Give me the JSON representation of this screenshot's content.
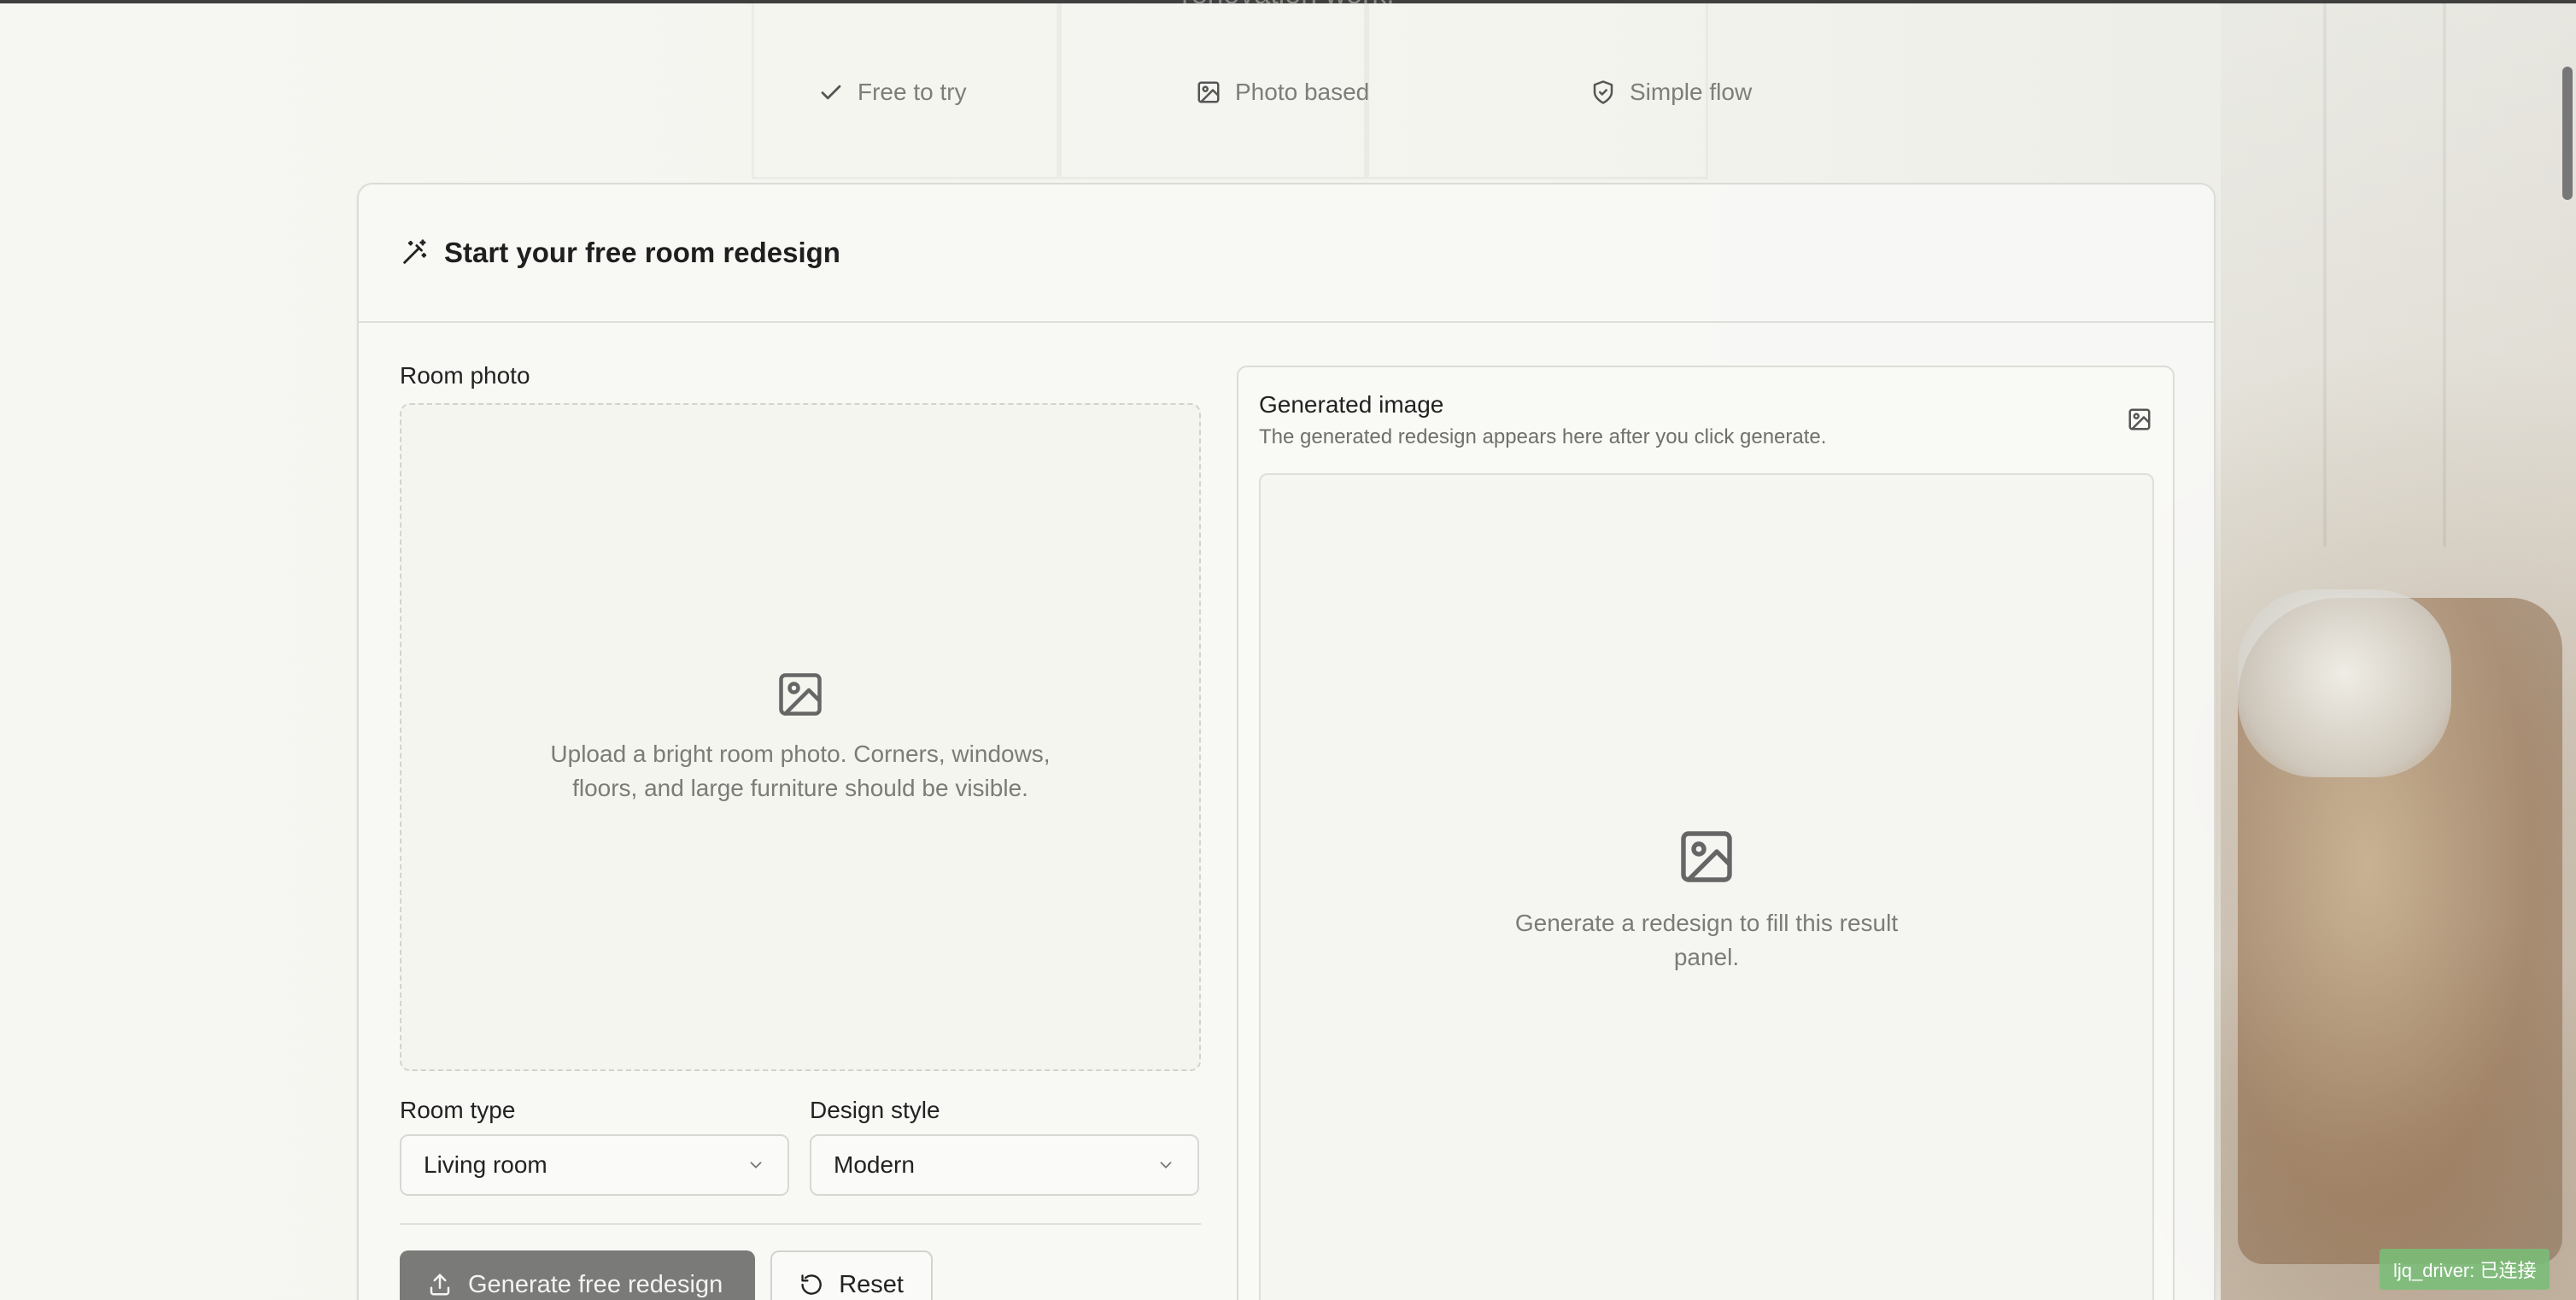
{
  "hero": {
    "subtitle": "renovation work."
  },
  "features": [
    {
      "label": "Free to try",
      "icon": "check-icon"
    },
    {
      "label": "Photo based",
      "icon": "image-icon"
    },
    {
      "label": "Simple flow",
      "icon": "shield-check-icon"
    }
  ],
  "card": {
    "title": "Start your free room redesign",
    "title_icon": "magic-wand-icon"
  },
  "upload": {
    "label": "Room photo",
    "hint": "Upload a bright room photo. Corners, windows, floors, and large furniture should be visible."
  },
  "room_type": {
    "label": "Room type",
    "value": "Living room"
  },
  "design_style": {
    "label": "Design style",
    "value": "Modern"
  },
  "buttons": {
    "generate": "Generate free redesign",
    "reset": "Reset"
  },
  "result": {
    "title": "Generated image",
    "description": "The generated redesign appears here after you click generate.",
    "empty": "Generate a redesign to fill this result panel."
  },
  "status": {
    "text": "ljq_driver: 已连接"
  },
  "colors": {
    "primary_button": "#7a7a78",
    "status_chip": "#78be78",
    "text_muted": "#7b7b77"
  }
}
